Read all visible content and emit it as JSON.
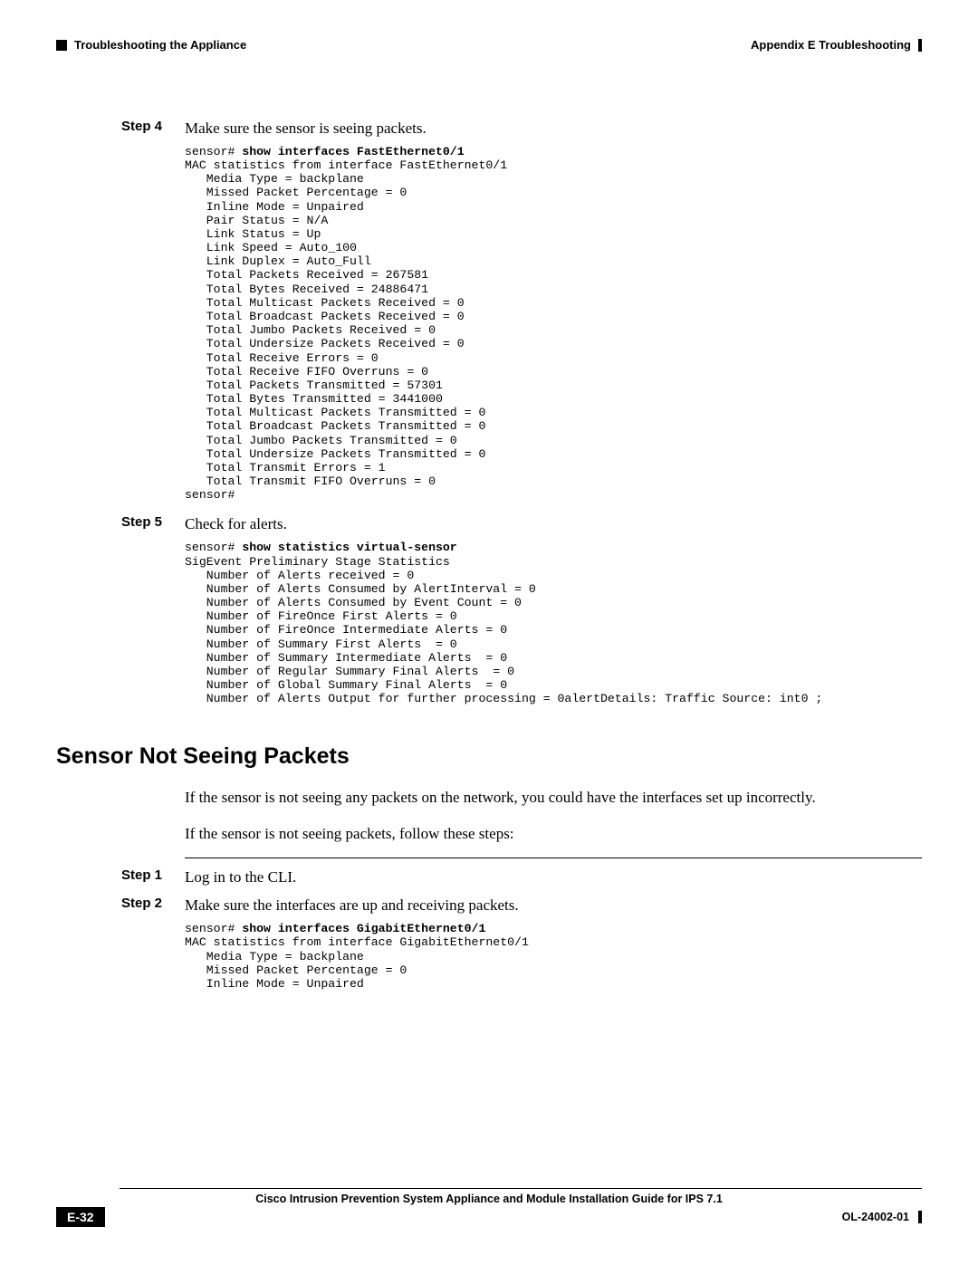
{
  "header": {
    "appendix": "Appendix E      Troubleshooting",
    "section": "Troubleshooting the Appliance"
  },
  "step4": {
    "label": "Step 4",
    "text": "Make sure the sensor is seeing packets.",
    "cmd_prefix": "sensor# ",
    "cmd_bold": "show interfaces FastEthernet0/1",
    "output": "MAC statistics from interface FastEthernet0/1\n   Media Type = backplane\n   Missed Packet Percentage = 0\n   Inline Mode = Unpaired\n   Pair Status = N/A\n   Link Status = Up\n   Link Speed = Auto_100\n   Link Duplex = Auto_Full\n   Total Packets Received = 267581\n   Total Bytes Received = 24886471\n   Total Multicast Packets Received = 0\n   Total Broadcast Packets Received = 0\n   Total Jumbo Packets Received = 0\n   Total Undersize Packets Received = 0\n   Total Receive Errors = 0\n   Total Receive FIFO Overruns = 0\n   Total Packets Transmitted = 57301\n   Total Bytes Transmitted = 3441000\n   Total Multicast Packets Transmitted = 0\n   Total Broadcast Packets Transmitted = 0\n   Total Jumbo Packets Transmitted = 0\n   Total Undersize Packets Transmitted = 0\n   Total Transmit Errors = 1\n   Total Transmit FIFO Overruns = 0\nsensor#"
  },
  "step5": {
    "label": "Step 5",
    "text": "Check for alerts.",
    "cmd_prefix": "sensor# ",
    "cmd_bold": "show statistics virtual-sensor",
    "output": "SigEvent Preliminary Stage Statistics\n   Number of Alerts received = 0\n   Number of Alerts Consumed by AlertInterval = 0\n   Number of Alerts Consumed by Event Count = 0\n   Number of FireOnce First Alerts = 0\n   Number of FireOnce Intermediate Alerts = 0\n   Number of Summary First Alerts  = 0\n   Number of Summary Intermediate Alerts  = 0\n   Number of Regular Summary Final Alerts  = 0\n   Number of Global Summary Final Alerts  = 0\n   Number of Alerts Output for further processing = 0alertDetails: Traffic Source: int0 ;"
  },
  "section2": {
    "heading": "Sensor Not Seeing Packets",
    "p1": "If the sensor is not seeing any packets on the network, you could have the interfaces set up incorrectly.",
    "p2": "If the sensor is not seeing packets, follow these steps:"
  },
  "step1b": {
    "label": "Step 1",
    "text": "Log in to the CLI."
  },
  "step2b": {
    "label": "Step 2",
    "text": "Make sure the interfaces are up and receiving packets.",
    "cmd_prefix": "sensor# ",
    "cmd_bold": "show interfaces GigabitEthernet0/1",
    "output": "MAC statistics from interface GigabitEthernet0/1\n   Media Type = backplane\n   Missed Packet Percentage = 0\n   Inline Mode = Unpaired"
  },
  "footer": {
    "title": "Cisco Intrusion Prevention System Appliance and Module Installation Guide for IPS 7.1",
    "page": "E-32",
    "doc": "OL-24002-01"
  }
}
